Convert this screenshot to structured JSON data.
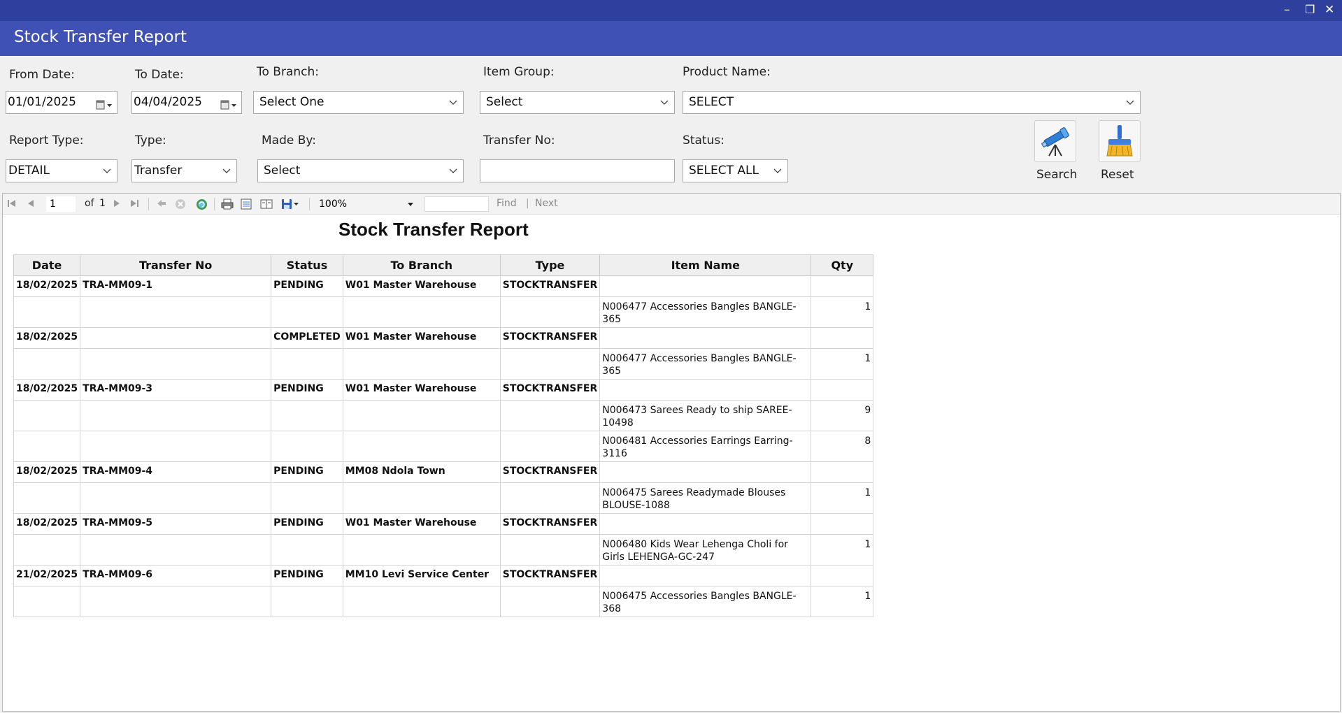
{
  "window": {
    "title": "Stock Transfer Report",
    "controls": {
      "minimize": "–",
      "restore": "❐",
      "close": "✕"
    }
  },
  "filters": {
    "from_date_label": "From Date:",
    "from_date_value": "01/01/2025",
    "to_date_label": "To Date:",
    "to_date_value": "04/04/2025",
    "to_branch_label": "To Branch:",
    "to_branch_value": "Select One",
    "item_group_label": "Item Group:",
    "item_group_value": "Select",
    "product_name_label": "Product Name:",
    "product_name_value": "SELECT",
    "report_type_label": "Report Type:",
    "report_type_value": "DETAIL",
    "type_label": "Type:",
    "type_value": "Transfer",
    "made_by_label": "Made By:",
    "made_by_value": "Select",
    "transfer_no_label": "Transfer No:",
    "transfer_no_value": "",
    "status_label": "Status:",
    "status_value": "SELECT ALL",
    "search_label": "Search",
    "reset_label": "Reset"
  },
  "toolbar": {
    "page_value": "1",
    "of_text": "of",
    "total_pages": "1",
    "zoom": "100%",
    "find_label": "Find",
    "separator": "|",
    "next_label": "Next"
  },
  "report": {
    "title": "Stock Transfer Report",
    "columns": [
      "Date",
      "Transfer No",
      "Status",
      "To Branch",
      "Type",
      "Item Name",
      "Qty"
    ],
    "rows": [
      {
        "kind": "parent",
        "cells": [
          "18/02/2025",
          "TRA-MM09-1",
          "PENDING",
          "W01 Master Warehouse",
          "STOCKTRANSFER",
          "",
          ""
        ]
      },
      {
        "kind": "child",
        "cells": [
          "",
          "",
          "",
          "",
          "",
          "N006477 Accessories Bangles BANGLE-365",
          "1"
        ]
      },
      {
        "kind": "parent",
        "cells": [
          "18/02/2025",
          "",
          "COMPLETED",
          "W01 Master Warehouse",
          "STOCKTRANSFER",
          "",
          ""
        ]
      },
      {
        "kind": "child",
        "cells": [
          "",
          "",
          "",
          "",
          "",
          "N006477 Accessories Bangles BANGLE-365",
          "1"
        ]
      },
      {
        "kind": "parent",
        "cells": [
          "18/02/2025",
          "TRA-MM09-3",
          "PENDING",
          "W01 Master Warehouse",
          "STOCKTRANSFER",
          "",
          ""
        ]
      },
      {
        "kind": "child",
        "cells": [
          "",
          "",
          "",
          "",
          "",
          "N006473 Sarees Ready to ship SAREE-10498",
          "9"
        ]
      },
      {
        "kind": "child",
        "cells": [
          "",
          "",
          "",
          "",
          "",
          "N006481 Accessories Earrings Earring-3116",
          "8"
        ]
      },
      {
        "kind": "parent",
        "cells": [
          "18/02/2025",
          "TRA-MM09-4",
          "PENDING",
          "MM08 Ndola Town",
          "STOCKTRANSFER",
          "",
          ""
        ]
      },
      {
        "kind": "child",
        "cells": [
          "",
          "",
          "",
          "",
          "",
          "N006475 Sarees Readymade Blouses BLOUSE-1088",
          "1"
        ]
      },
      {
        "kind": "parent",
        "cells": [
          "18/02/2025",
          "TRA-MM09-5",
          "PENDING",
          "W01 Master Warehouse",
          "STOCKTRANSFER",
          "",
          ""
        ]
      },
      {
        "kind": "child",
        "cells": [
          "",
          "",
          "",
          "",
          "",
          "N006480 Kids Wear Lehenga Choli for Girls LEHENGA-GC-247",
          "1"
        ]
      },
      {
        "kind": "parent",
        "cells": [
          "21/02/2025",
          "TRA-MM09-6",
          "PENDING",
          "MM10 Levi Service Center",
          "STOCKTRANSFER",
          "",
          ""
        ]
      },
      {
        "kind": "child",
        "cells": [
          "",
          "",
          "",
          "",
          "",
          "N006475 Accessories Bangles BANGLE-368",
          "1"
        ]
      }
    ]
  }
}
